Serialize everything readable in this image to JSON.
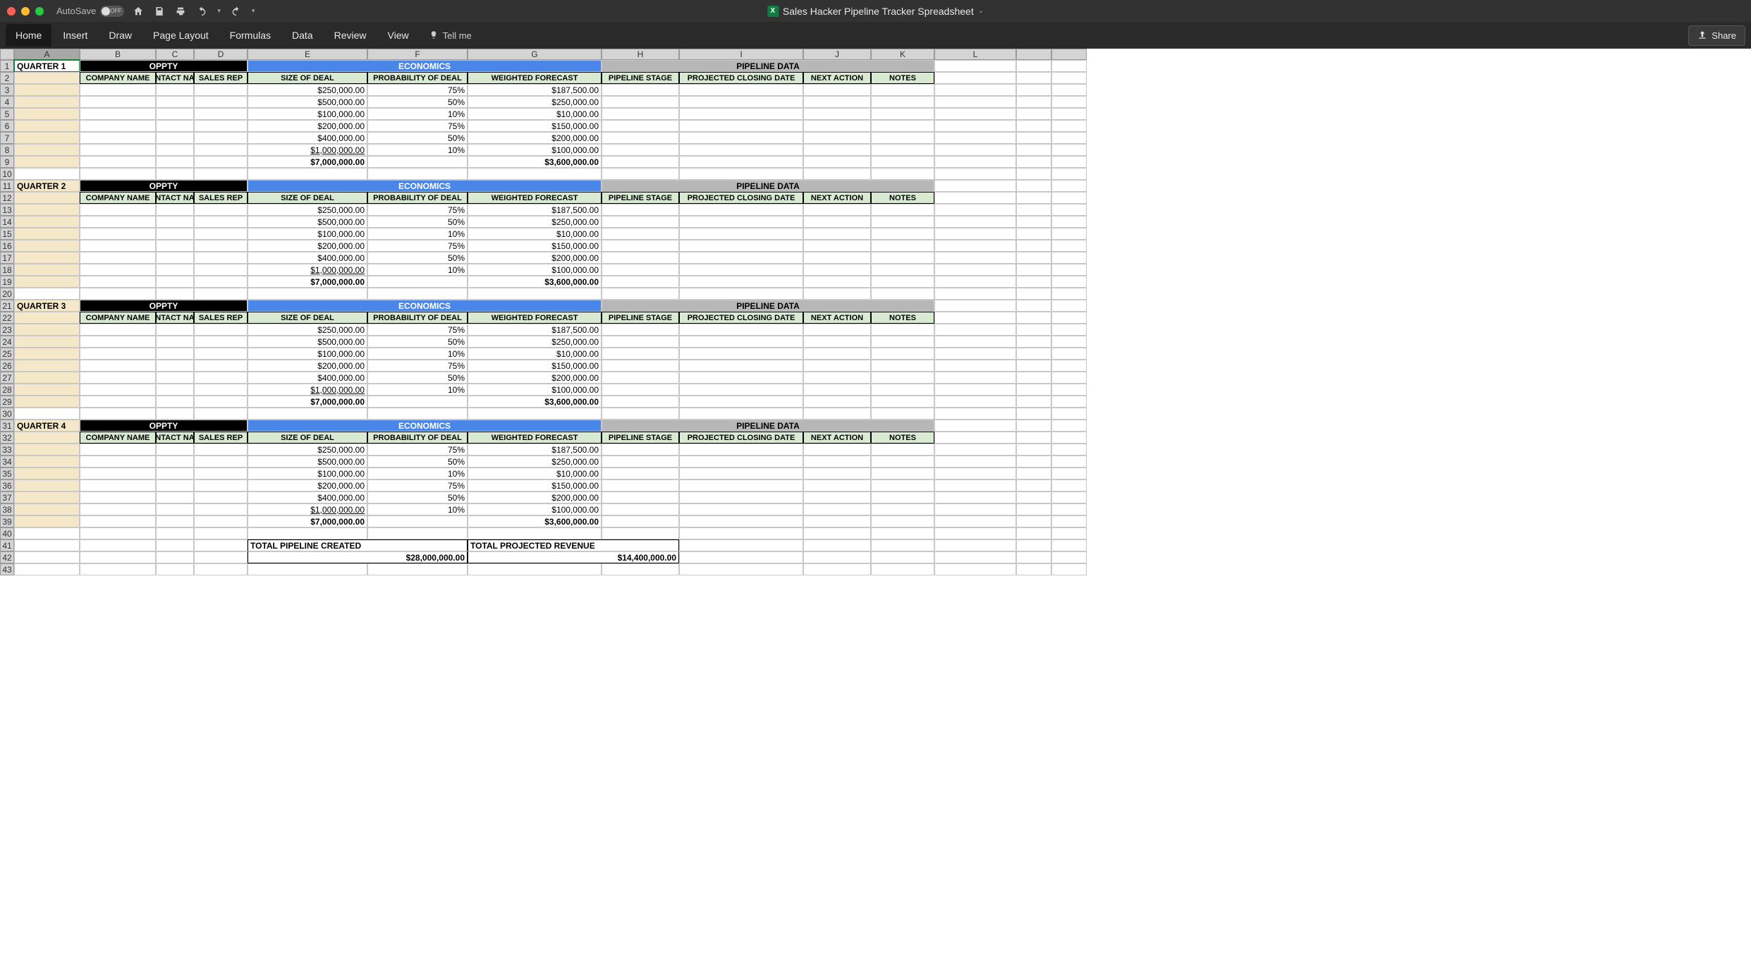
{
  "titlebar": {
    "autosave_label": "AutoSave",
    "autosave_state": "OFF",
    "doc_title": "Sales Hacker Pipeline Tracker Spreadsheet"
  },
  "ribbon": {
    "tabs": [
      "Home",
      "Insert",
      "Draw",
      "Page Layout",
      "Formulas",
      "Data",
      "Review",
      "View"
    ],
    "tell_me": "Tell me",
    "share": "Share"
  },
  "columns": [
    "A",
    "B",
    "C",
    "D",
    "E",
    "F",
    "G",
    "H",
    "I",
    "J",
    "K",
    "L"
  ],
  "section_headers": {
    "oppty": "OPPTY",
    "economics": "ECONOMICS",
    "pipeline": "PIPELINE DATA"
  },
  "col_headers": {
    "company": "COMPANY NAME",
    "contact": "CONTACT NAME",
    "rep": "SALES REP",
    "size": "SIZE OF DEAL",
    "prob": "PROBABILITY OF DEAL",
    "forecast": "WEIGHTED FORECAST",
    "stage": "PIPELINE STAGE",
    "close": "PROJECTED CLOSING DATE",
    "action": "NEXT ACTION",
    "notes": "NOTES"
  },
  "quarters": [
    {
      "label": "QUARTER 1"
    },
    {
      "label": "QUARTER 2"
    },
    {
      "label": "QUARTER 3"
    },
    {
      "label": "QUARTER 4"
    }
  ],
  "data_rows": [
    {
      "size": "$250,000.00",
      "prob": "75%",
      "forecast": "$187,500.00"
    },
    {
      "size": "$500,000.00",
      "prob": "50%",
      "forecast": "$250,000.00"
    },
    {
      "size": "$100,000.00",
      "prob": "10%",
      "forecast": "$10,000.00"
    },
    {
      "size": "$200,000.00",
      "prob": "75%",
      "forecast": "$150,000.00"
    },
    {
      "size": "$400,000.00",
      "prob": "50%",
      "forecast": "$200,000.00"
    },
    {
      "size": "$1,000,000.00",
      "prob": "10%",
      "forecast": "$100,000.00",
      "underline": true
    }
  ],
  "totals": {
    "size": "$7,000,000.00",
    "forecast": "$3,600,000.00"
  },
  "summary": {
    "pipeline_label": "TOTAL PIPELINE CREATED",
    "pipeline_value": "$28,000,000.00",
    "revenue_label": "TOTAL PROJECTED REVENUE",
    "revenue_value": "$14,400,000.00"
  }
}
